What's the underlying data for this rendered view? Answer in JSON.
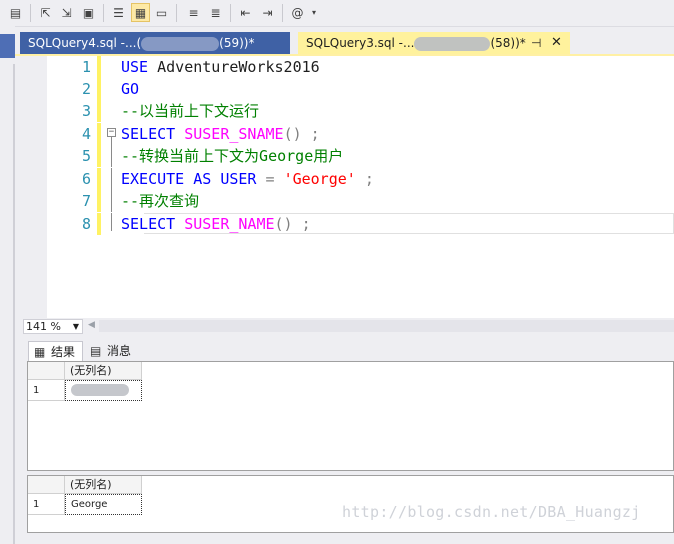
{
  "toolbar": {
    "icons": [
      "pane-icon",
      "indent-icon",
      "outdent-icon",
      "display-plan-icon",
      "results-text-icon",
      "results-grid-icon",
      "results-file-icon",
      "comment-icon",
      "uncomment-icon",
      "decrease-indent-icon",
      "increase-indent-icon",
      "specify-values-icon"
    ]
  },
  "tabs": [
    {
      "prefix": "SQLQuery4.sql -...(",
      "suffix": "(59))*",
      "active": false
    },
    {
      "prefix": "SQLQuery3.sql -...",
      "suffix": "(58))*",
      "active": true
    }
  ],
  "editor": {
    "lines": [
      {
        "num": "1",
        "kw1": "USE",
        "rest": " AdventureWorks2016"
      },
      {
        "num": "2",
        "kw1": "GO"
      },
      {
        "num": "3",
        "comment": "--以当前上下文运行"
      },
      {
        "num": "4",
        "kw1": "SELECT",
        "fn": "SUSER_SNAME",
        "tail": "() ;"
      },
      {
        "num": "5",
        "comment": "--转换当前上下文为George用户"
      },
      {
        "num": "6",
        "kw1": "EXECUTE AS USER",
        "op": " = ",
        "str": "'George'",
        "tail": " ;"
      },
      {
        "num": "7",
        "comment": "--再次查询"
      },
      {
        "num": "8",
        "kw1": "SELECT",
        "fn": "SUSER_NAME",
        "tail": "() ;"
      }
    ]
  },
  "zoom": {
    "value": "141 %"
  },
  "result_tabs": {
    "results": "结果",
    "messages": "消息"
  },
  "grid1": {
    "header": "(无列名)",
    "row": "1",
    "value": ""
  },
  "grid2": {
    "header": "(无列名)",
    "row": "1",
    "value": "George"
  },
  "watermark": "http://blog.csdn.net/DBA_Huangzj"
}
